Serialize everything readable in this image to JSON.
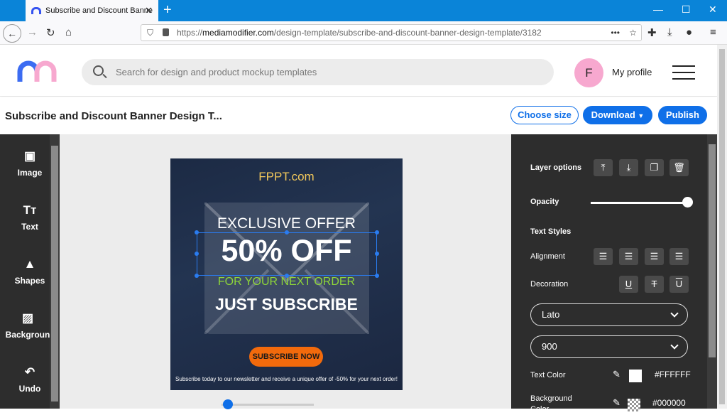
{
  "browser": {
    "tab_title": "Subscribe and Discount Banne",
    "url_prefix": "https://",
    "url_host": "mediamodifier.com",
    "url_path": "/design-template/subscribe-and-discount-banner-design-template/3182"
  },
  "site": {
    "search_placeholder": "Search for design and product mockup templates",
    "avatar_letter": "F",
    "profile_label": "My profile"
  },
  "editor": {
    "doc_title": "Subscribe and Discount Banner Design T...",
    "choose_size": "Choose size",
    "download": "Download",
    "publish": "Publish"
  },
  "tools": [
    {
      "label": "Image"
    },
    {
      "label": "Text"
    },
    {
      "label": "Shapes"
    },
    {
      "label": "Backgroun"
    },
    {
      "label": "Undo"
    }
  ],
  "banner": {
    "brand": "FPPT.com",
    "line1": "EXCLUSIVE OFFER",
    "line2": "50% OFF",
    "line3": "FOR YOUR NEXT ORDER",
    "line4": "JUST SUBSCRIBE",
    "cta": "SUBSCRIBE NOW",
    "footnote": "Subscribe today to our newsletter and receive a unique offer of -50% for your next order!"
  },
  "panel": {
    "layer_options": "Layer options",
    "opacity": "Opacity",
    "opacity_value": 1.0,
    "text_styles": "Text Styles",
    "alignment": "Alignment",
    "decoration": "Decoration",
    "font_family": "Lato",
    "font_weight": "900",
    "text_color_label": "Text Color",
    "text_color": "#FFFFFF",
    "background_label": "Background Color",
    "background_color": "#000000"
  },
  "colors": {
    "accent": "#0f6fe8",
    "panel": "#2d2d2d",
    "cta": "#f26a0c",
    "brand": "#f2c85b",
    "green": "#8ed639"
  }
}
